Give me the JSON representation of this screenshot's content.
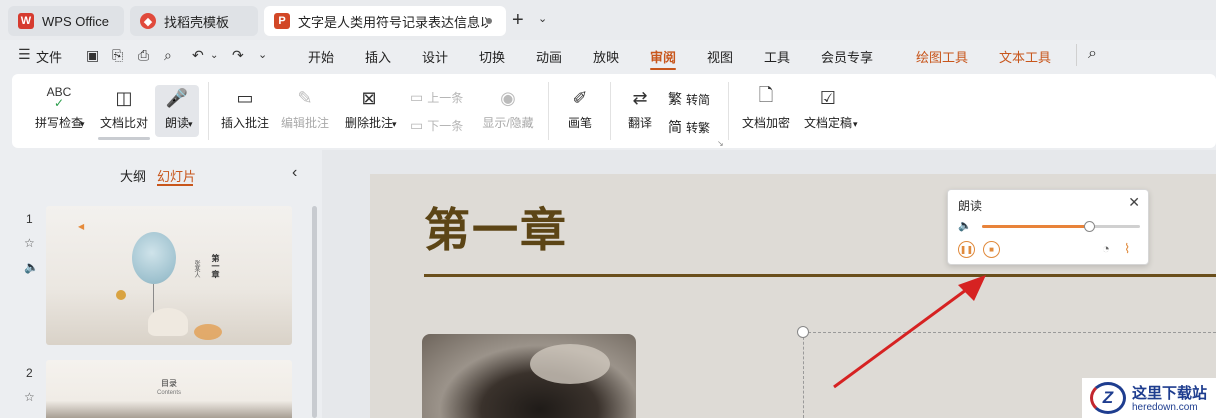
{
  "tabs": [
    {
      "label": "WPS Office",
      "icon": "wps-logo-icon"
    },
    {
      "label": "找稻壳模板",
      "icon": "docer-icon"
    },
    {
      "label": "文字是人类用符号记录表达信息以",
      "icon": "presentation-icon"
    }
  ],
  "menubar": {
    "file": "文件",
    "items": [
      "开始",
      "插入",
      "设计",
      "切换",
      "动画",
      "放映",
      "审阅",
      "视图",
      "工具",
      "会员专享",
      "绘图工具",
      "文本工具"
    ],
    "active": "审阅"
  },
  "ribbon": {
    "spellcheck": "拼写检查",
    "compare": "文档比对",
    "readaloud": "朗读",
    "insert_comment": "插入批注",
    "edit_comment": "编辑批注",
    "delete_comment": "删除批注",
    "prev": "上一条",
    "next": "下一条",
    "show_hide": "显示/隐藏",
    "pen": "画笔",
    "translate": "翻译",
    "to_simplified": "转简",
    "to_traditional": "转繁",
    "encrypt": "文档加密",
    "finalize": "文档定稿",
    "abc": "ABC"
  },
  "leftpane": {
    "outline_tab": "大纲",
    "slides_tab": "幻灯片",
    "slide_numbers": [
      "1",
      "2"
    ],
    "thumb1_title": "第一章",
    "thumb1_sub": "张某人",
    "thumb2_title": "目录",
    "thumb2_sub": "Contents"
  },
  "slide": {
    "title": "第一章"
  },
  "read_panel": {
    "title": "朗读",
    "volume_level": 0.68
  },
  "watermark": {
    "name": "这里下载站",
    "url": "heredown.com",
    "logo_letter": "Z"
  }
}
